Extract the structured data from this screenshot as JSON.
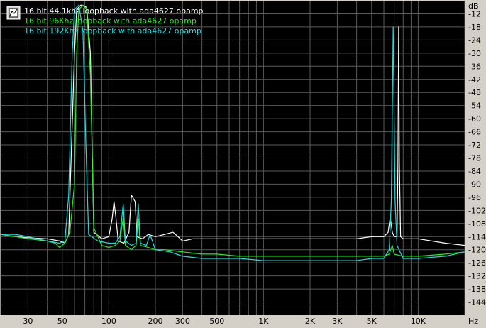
{
  "chart_data": {
    "type": "line",
    "x_scale": "log",
    "xlim": [
      20,
      20000
    ],
    "ylim": [
      -150,
      -6
    ],
    "y_unit_label": "dB",
    "x_unit_label": "Hz",
    "y_ticks": [
      -12,
      -18,
      -24,
      -30,
      -36,
      -42,
      -48,
      -54,
      -60,
      -66,
      -72,
      -78,
      -84,
      -90,
      -96,
      -102,
      -108,
      -114,
      -120,
      -126,
      -132,
      -138,
      -144
    ],
    "x_ticks": [
      {
        "value": 30,
        "label": "30"
      },
      {
        "value": 50,
        "label": "50"
      },
      {
        "value": 100,
        "label": "100"
      },
      {
        "value": 200,
        "label": "200"
      },
      {
        "value": 300,
        "label": "300"
      },
      {
        "value": 500,
        "label": "500"
      },
      {
        "value": 1000,
        "label": "1K"
      },
      {
        "value": 2000,
        "label": "2K"
      },
      {
        "value": 3000,
        "label": "3K"
      },
      {
        "value": 5000,
        "label": "5K"
      },
      {
        "value": 10000,
        "label": "10K"
      }
    ],
    "grid": true,
    "legend_position": "top-left",
    "background": "#000000",
    "series": [
      {
        "name": "16 bit 44.1khz loopback with ada4627 opamp",
        "color": "#ffffff",
        "points": [
          [
            20,
            -113
          ],
          [
            25,
            -114
          ],
          [
            30,
            -114.5
          ],
          [
            40,
            -115
          ],
          [
            48,
            -116
          ],
          [
            52,
            -117
          ],
          [
            55,
            -113
          ],
          [
            60,
            -30
          ],
          [
            62,
            -10
          ],
          [
            66,
            -8
          ],
          [
            72,
            -9
          ],
          [
            76,
            -30
          ],
          [
            80,
            -112
          ],
          [
            90,
            -115
          ],
          [
            100,
            -114
          ],
          [
            105,
            -106
          ],
          [
            108,
            -98
          ],
          [
            111,
            -105
          ],
          [
            115,
            -116
          ],
          [
            125,
            -117
          ],
          [
            135,
            -112
          ],
          [
            140,
            -95
          ],
          [
            148,
            -98
          ],
          [
            152,
            -114
          ],
          [
            165,
            -115
          ],
          [
            180,
            -113
          ],
          [
            200,
            -114
          ],
          [
            230,
            -113
          ],
          [
            260,
            -112
          ],
          [
            280,
            -114
          ],
          [
            300,
            -116
          ],
          [
            350,
            -115
          ],
          [
            400,
            -115
          ],
          [
            500,
            -115
          ],
          [
            700,
            -115
          ],
          [
            1000,
            -115
          ],
          [
            1500,
            -115
          ],
          [
            2000,
            -115
          ],
          [
            3000,
            -115
          ],
          [
            4000,
            -115
          ],
          [
            5000,
            -114
          ],
          [
            6000,
            -114
          ],
          [
            6400,
            -112
          ],
          [
            6600,
            -105
          ],
          [
            6800,
            -112
          ],
          [
            7000,
            -114
          ],
          [
            7300,
            -114
          ],
          [
            7400,
            -80
          ],
          [
            7480,
            -18
          ],
          [
            7560,
            -80
          ],
          [
            7700,
            -114
          ],
          [
            8000,
            -115
          ],
          [
            10000,
            -115
          ],
          [
            15000,
            -117
          ],
          [
            20000,
            -118
          ]
        ]
      },
      {
        "name": "16 bit 96Khz loopback with ada4627 opamp",
        "color": "#22ee22",
        "points": [
          [
            20,
            -113
          ],
          [
            25,
            -114
          ],
          [
            30,
            -115
          ],
          [
            40,
            -116
          ],
          [
            45,
            -117
          ],
          [
            48,
            -119
          ],
          [
            52,
            -117
          ],
          [
            56,
            -112
          ],
          [
            60,
            -90
          ],
          [
            62,
            -30
          ],
          [
            64,
            -10
          ],
          [
            68,
            -8
          ],
          [
            72,
            -10
          ],
          [
            76,
            -40
          ],
          [
            80,
            -110
          ],
          [
            90,
            -118
          ],
          [
            100,
            -119
          ],
          [
            110,
            -118
          ],
          [
            118,
            -116
          ],
          [
            124,
            -105
          ],
          [
            128,
            -118
          ],
          [
            140,
            -120
          ],
          [
            150,
            -118
          ],
          [
            155,
            -106
          ],
          [
            160,
            -118
          ],
          [
            180,
            -119
          ],
          [
            200,
            -120
          ],
          [
            230,
            -120
          ],
          [
            300,
            -121
          ],
          [
            400,
            -122
          ],
          [
            500,
            -122
          ],
          [
            700,
            -123
          ],
          [
            1000,
            -123
          ],
          [
            1500,
            -123
          ],
          [
            2000,
            -123
          ],
          [
            3000,
            -123
          ],
          [
            4000,
            -123
          ],
          [
            5000,
            -123
          ],
          [
            6000,
            -123
          ],
          [
            6500,
            -122
          ],
          [
            6800,
            -118
          ],
          [
            7000,
            -122
          ],
          [
            8000,
            -123
          ],
          [
            10000,
            -123
          ],
          [
            15000,
            -122
          ],
          [
            20000,
            -121
          ]
        ]
      },
      {
        "name": "16 bit 192Khz loopback with ada4627 opamp",
        "color": "#22dddd",
        "points": [
          [
            20,
            -113
          ],
          [
            25,
            -113
          ],
          [
            30,
            -114
          ],
          [
            40,
            -116
          ],
          [
            48,
            -117
          ],
          [
            52,
            -116
          ],
          [
            55,
            -95
          ],
          [
            58,
            -30
          ],
          [
            60,
            -10
          ],
          [
            64,
            -8
          ],
          [
            68,
            -20
          ],
          [
            71,
            -70
          ],
          [
            74,
            -113
          ],
          [
            85,
            -116
          ],
          [
            100,
            -117
          ],
          [
            110,
            -117
          ],
          [
            118,
            -114
          ],
          [
            124,
            -99
          ],
          [
            128,
            -116
          ],
          [
            140,
            -118
          ],
          [
            150,
            -117
          ],
          [
            155,
            -99
          ],
          [
            160,
            -117
          ],
          [
            175,
            -118
          ],
          [
            185,
            -113
          ],
          [
            200,
            -120
          ],
          [
            250,
            -121
          ],
          [
            300,
            -123
          ],
          [
            400,
            -124
          ],
          [
            500,
            -124
          ],
          [
            700,
            -124
          ],
          [
            1000,
            -125
          ],
          [
            1500,
            -125
          ],
          [
            2000,
            -125
          ],
          [
            3000,
            -125
          ],
          [
            4000,
            -125
          ],
          [
            5000,
            -124
          ],
          [
            6000,
            -124
          ],
          [
            6500,
            -120
          ],
          [
            6700,
            -98
          ],
          [
            6900,
            -18
          ],
          [
            7100,
            -98
          ],
          [
            7300,
            -118
          ],
          [
            8000,
            -124
          ],
          [
            10000,
            -124
          ],
          [
            15000,
            -123
          ],
          [
            20000,
            -121
          ]
        ]
      }
    ]
  }
}
